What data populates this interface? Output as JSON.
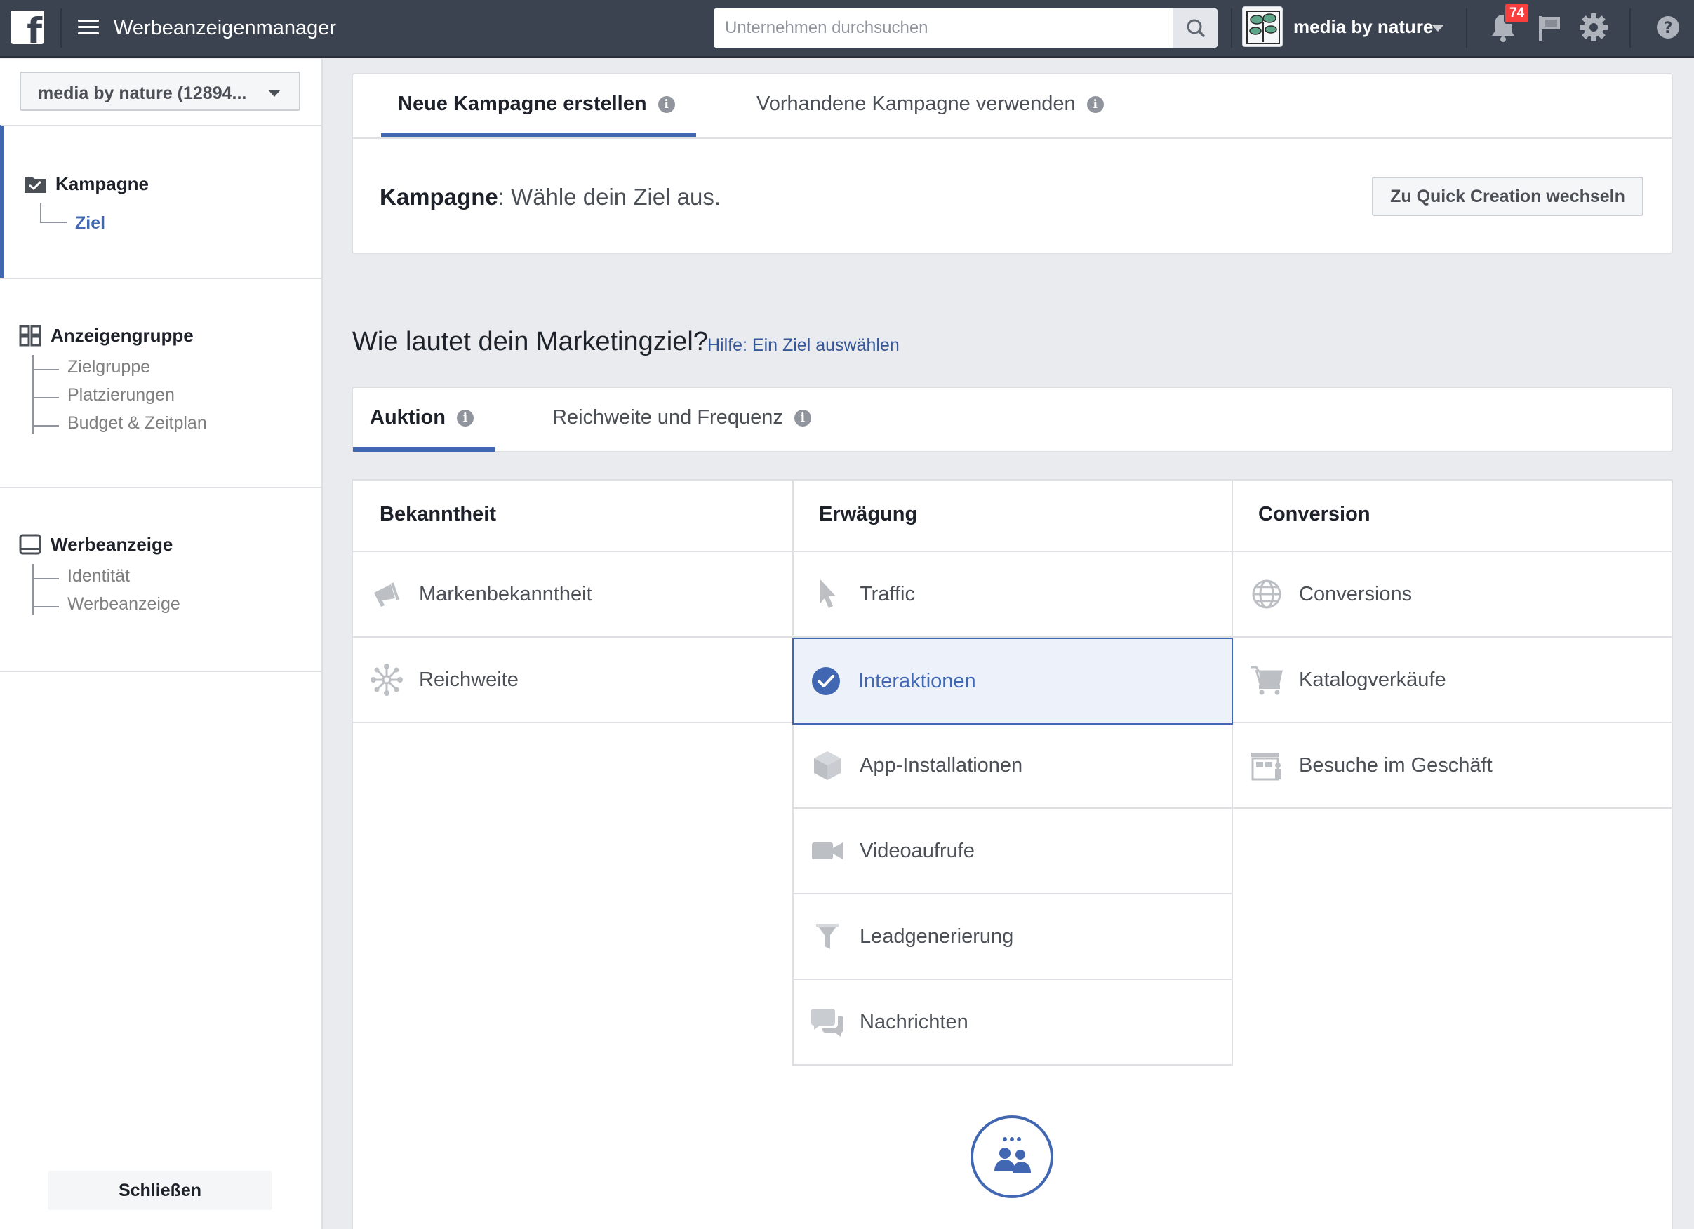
{
  "topbar": {
    "logo_letter": "f",
    "app_title": "Werbeanzeigenmanager",
    "search_placeholder": "Unternehmen durchsuchen",
    "account_name": "media by nature",
    "notification_count": "74"
  },
  "sidebar": {
    "account_select": "media by nature (12894...",
    "sections": [
      {
        "title": "Kampagne",
        "items": [
          "Ziel"
        ]
      },
      {
        "title": "Anzeigengruppe",
        "items": [
          "Zielgruppe",
          "Platzierungen",
          "Budget & Zeitplan"
        ]
      },
      {
        "title": "Werbeanzeige",
        "items": [
          "Identität",
          "Werbeanzeige"
        ]
      }
    ],
    "close_label": "Schließen"
  },
  "campaign_tabs": [
    {
      "label": "Neue Kampagne erstellen",
      "active": true
    },
    {
      "label": "Vorhandene Kampagne verwenden",
      "active": false
    }
  ],
  "campaign_line": {
    "bold": "Kampagne",
    "rest": ": Wähle dein Ziel aus."
  },
  "quick_creation_label": "Zu Quick Creation wechseln",
  "question": "Wie lautet dein Marketingziel?",
  "help_link": "Hilfe: Ein Ziel auswählen",
  "buying_tabs": [
    {
      "label": "Auktion",
      "active": true
    },
    {
      "label": "Reichweite und Frequenz",
      "active": false
    }
  ],
  "objectives": {
    "columns": [
      {
        "header": "Bekanntheit",
        "items": [
          {
            "label": "Markenbekanntheit",
            "icon": "megaphone-icon"
          },
          {
            "label": "Reichweite",
            "icon": "reach-icon"
          }
        ]
      },
      {
        "header": "Erwägung",
        "items": [
          {
            "label": "Traffic",
            "icon": "cursor-icon"
          },
          {
            "label": "Interaktionen",
            "icon": "check-circle-icon",
            "selected": true
          },
          {
            "label": "App-Installationen",
            "icon": "box-icon"
          },
          {
            "label": "Videoaufrufe",
            "icon": "video-camera-icon"
          },
          {
            "label": "Leadgenerierung",
            "icon": "funnel-icon"
          },
          {
            "label": "Nachrichten",
            "icon": "chat-bubbles-icon"
          }
        ]
      },
      {
        "header": "Conversion",
        "items": [
          {
            "label": "Conversions",
            "icon": "globe-icon"
          },
          {
            "label": "Katalogverkäufe",
            "icon": "cart-icon"
          },
          {
            "label": "Besuche im Geschäft",
            "icon": "store-icon"
          }
        ]
      }
    ]
  },
  "colors": {
    "topbar": "#3b4351",
    "accent": "#4267b2",
    "selected_bg": "#edf2fa",
    "badge": "#fa3e3e"
  }
}
